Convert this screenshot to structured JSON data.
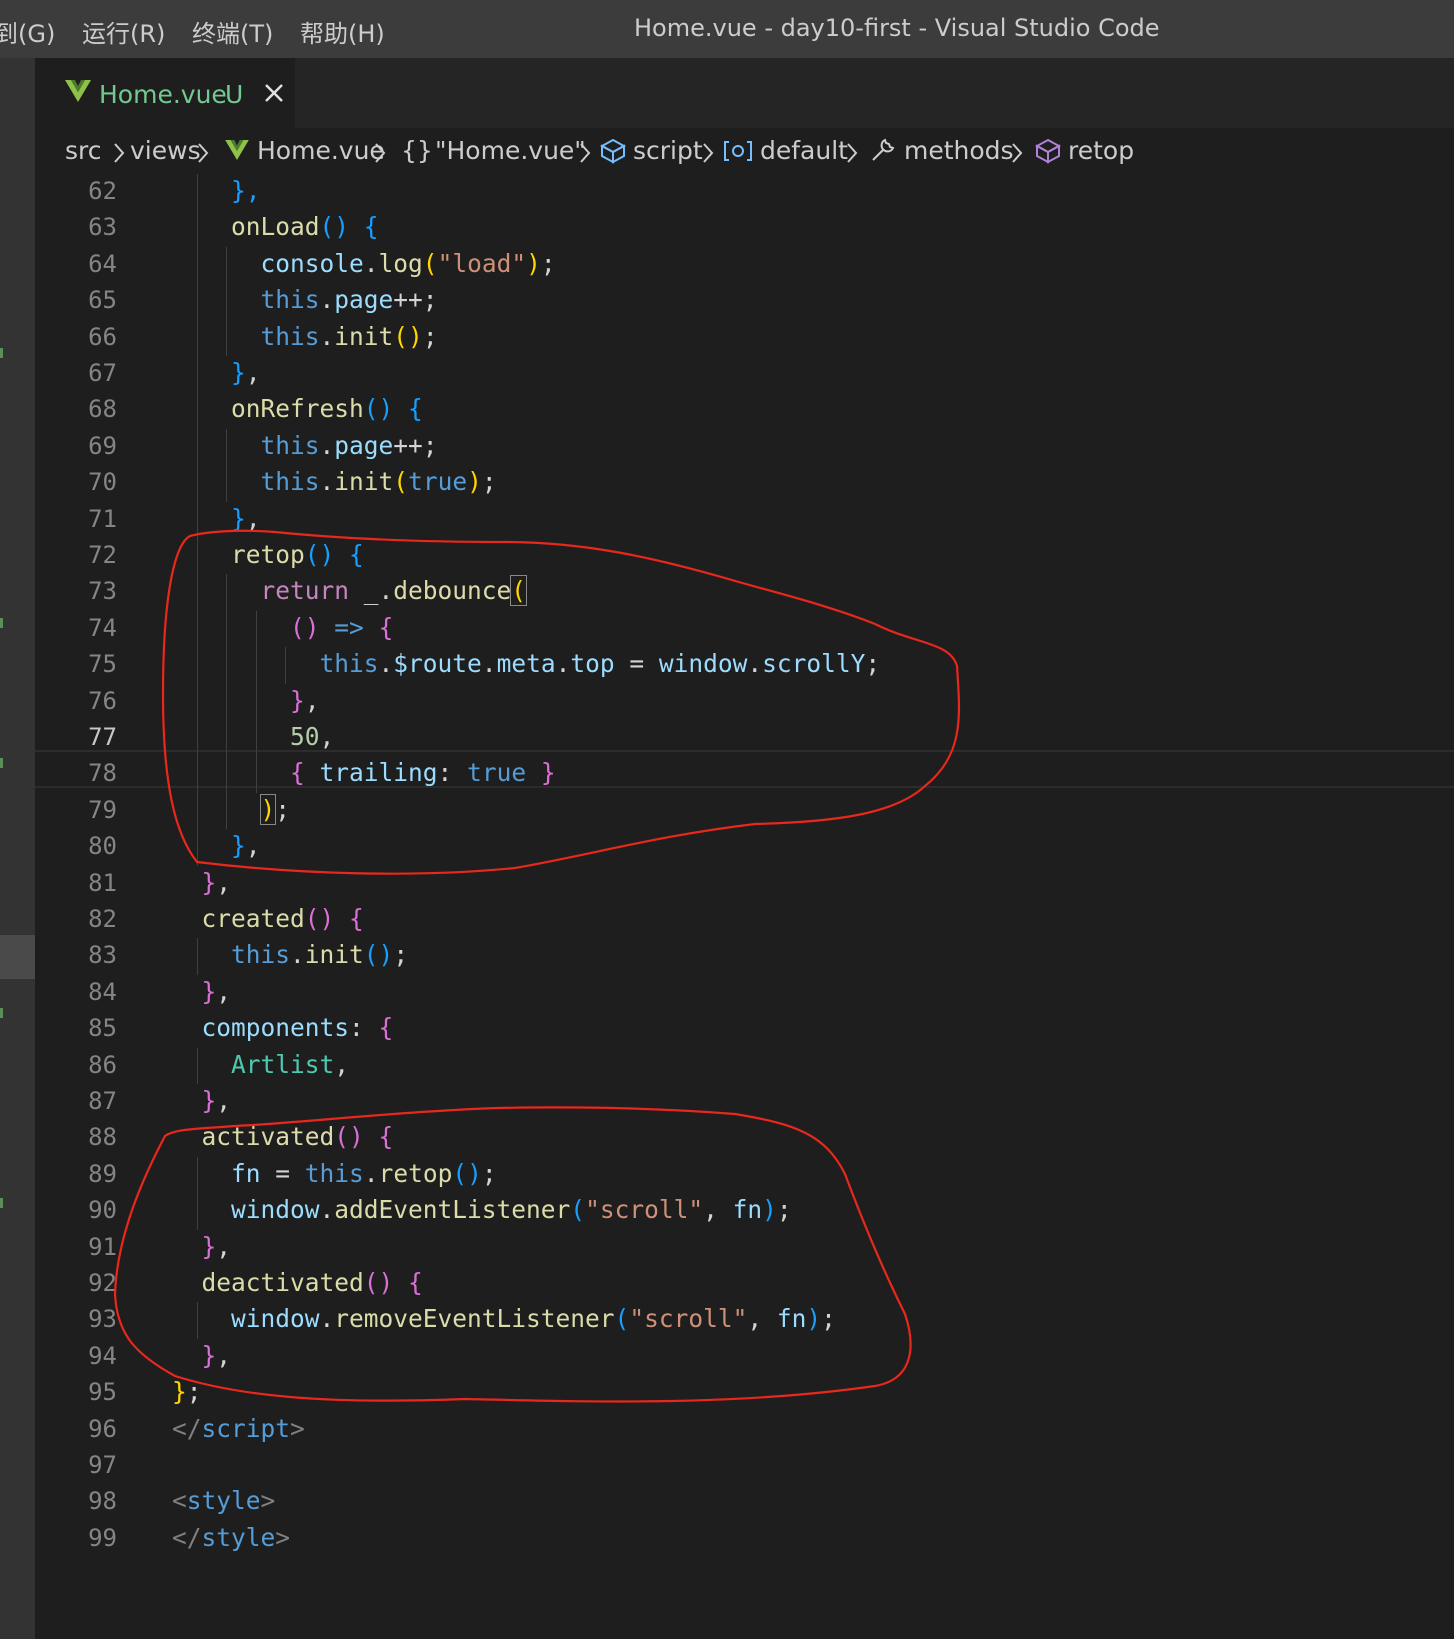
{
  "titlebar": {
    "menus": [
      "到(G)",
      "运行(R)",
      "终端(T)",
      "帮助(H)"
    ],
    "window_title": "Home.vue - day10-first - Visual Studio Code"
  },
  "tab": {
    "label": "Home.vue",
    "status": "U",
    "icon": "vue-icon",
    "close_icon": "close-icon"
  },
  "breadcrumb": {
    "items": [
      "src",
      "views",
      "Home.vue",
      "\"Home.vue\"",
      "script",
      "default",
      "methods",
      "retop"
    ],
    "icons": [
      "",
      "",
      "vue-icon",
      "braces-icon",
      "cube-icon",
      "variable-icon",
      "wrench-icon",
      "cube-icon"
    ]
  },
  "editor": {
    "active_line": 77,
    "lines": [
      {
        "n": 62,
        "indent": 2,
        "t": [
          [
            "},",
            "br3"
          ]
        ]
      },
      {
        "n": 63,
        "indent": 2,
        "t": [
          [
            "onLoad",
            "tk-fn"
          ],
          [
            "()",
            "br3"
          ],
          [
            " ",
            "tk-plain"
          ],
          [
            "{",
            "br3"
          ]
        ]
      },
      {
        "n": 64,
        "indent": 3,
        "t": [
          [
            "console",
            "tk-key"
          ],
          [
            ".",
            "tk-plain"
          ],
          [
            "log",
            "tk-fn"
          ],
          [
            "(",
            "br1"
          ],
          [
            "\"load\"",
            "tk-str"
          ],
          [
            ")",
            "br1"
          ],
          [
            ";",
            "tk-plain"
          ]
        ]
      },
      {
        "n": 65,
        "indent": 3,
        "t": [
          [
            "this",
            "tk-kw"
          ],
          [
            ".",
            "tk-plain"
          ],
          [
            "page",
            "tk-key"
          ],
          [
            "++;",
            "tk-plain"
          ]
        ]
      },
      {
        "n": 66,
        "indent": 3,
        "t": [
          [
            "this",
            "tk-kw"
          ],
          [
            ".",
            "tk-plain"
          ],
          [
            "init",
            "tk-fn"
          ],
          [
            "()",
            "br1"
          ],
          [
            ";",
            "tk-plain"
          ]
        ]
      },
      {
        "n": 67,
        "indent": 2,
        "t": [
          [
            "}",
            "br3"
          ],
          [
            ",",
            "tk-plain"
          ]
        ]
      },
      {
        "n": 68,
        "indent": 2,
        "t": [
          [
            "onRefresh",
            "tk-fn"
          ],
          [
            "()",
            "br3"
          ],
          [
            " ",
            "tk-plain"
          ],
          [
            "{",
            "br3"
          ]
        ]
      },
      {
        "n": 69,
        "indent": 3,
        "t": [
          [
            "this",
            "tk-kw"
          ],
          [
            ".",
            "tk-plain"
          ],
          [
            "page",
            "tk-key"
          ],
          [
            "++;",
            "tk-plain"
          ]
        ]
      },
      {
        "n": 70,
        "indent": 3,
        "t": [
          [
            "this",
            "tk-kw"
          ],
          [
            ".",
            "tk-plain"
          ],
          [
            "init",
            "tk-fn"
          ],
          [
            "(",
            "br1"
          ],
          [
            "true",
            "tk-kw"
          ],
          [
            ")",
            "br1"
          ],
          [
            ";",
            "tk-plain"
          ]
        ]
      },
      {
        "n": 71,
        "indent": 2,
        "t": [
          [
            "}",
            "br3"
          ],
          [
            ",",
            "tk-plain"
          ]
        ]
      },
      {
        "n": 72,
        "indent": 2,
        "t": [
          [
            "retop",
            "tk-fn"
          ],
          [
            "()",
            "br3"
          ],
          [
            " ",
            "tk-plain"
          ],
          [
            "{",
            "br3"
          ]
        ]
      },
      {
        "n": 73,
        "indent": 3,
        "t": [
          [
            "return",
            "tk-ctl"
          ],
          [
            " _.",
            "tk-plain"
          ],
          [
            "debounce",
            "tk-fn"
          ],
          [
            "(",
            "br1 match"
          ]
        ]
      },
      {
        "n": 74,
        "indent": 4,
        "t": [
          [
            "()",
            "br2"
          ],
          [
            " ",
            "tk-plain"
          ],
          [
            "=>",
            "tk-kw"
          ],
          [
            " ",
            "tk-plain"
          ],
          [
            "{",
            "br2"
          ]
        ]
      },
      {
        "n": 75,
        "indent": 5,
        "t": [
          [
            "this",
            "tk-kw"
          ],
          [
            ".",
            "tk-plain"
          ],
          [
            "$route",
            "tk-key"
          ],
          [
            ".",
            "tk-plain"
          ],
          [
            "meta",
            "tk-key"
          ],
          [
            ".",
            "tk-plain"
          ],
          [
            "top",
            "tk-key"
          ],
          [
            " = ",
            "tk-plain"
          ],
          [
            "window",
            "tk-key"
          ],
          [
            ".",
            "tk-plain"
          ],
          [
            "scrollY",
            "tk-key"
          ],
          [
            ";",
            "tk-plain"
          ]
        ]
      },
      {
        "n": 76,
        "indent": 4,
        "t": [
          [
            "}",
            "br2"
          ],
          [
            ",",
            "tk-plain"
          ]
        ]
      },
      {
        "n": 77,
        "indent": 4,
        "t": [
          [
            "50",
            "tk-num"
          ],
          [
            ",",
            "tk-plain"
          ]
        ]
      },
      {
        "n": 78,
        "indent": 4,
        "t": [
          [
            "{",
            "br2"
          ],
          [
            " ",
            "tk-plain"
          ],
          [
            "trailing",
            "tk-key"
          ],
          [
            ": ",
            "tk-plain"
          ],
          [
            "true",
            "tk-kw"
          ],
          [
            " ",
            "tk-plain"
          ],
          [
            "}",
            "br2"
          ]
        ]
      },
      {
        "n": 79,
        "indent": 3,
        "t": [
          [
            ")",
            "br1 match"
          ],
          [
            ";",
            "tk-plain"
          ]
        ]
      },
      {
        "n": 80,
        "indent": 2,
        "t": [
          [
            "}",
            "br3"
          ],
          [
            ",",
            "tk-plain"
          ]
        ]
      },
      {
        "n": 81,
        "indent": 1,
        "t": [
          [
            "}",
            "br2"
          ],
          [
            ",",
            "tk-plain"
          ]
        ]
      },
      {
        "n": 82,
        "indent": 1,
        "t": [
          [
            "created",
            "tk-fn"
          ],
          [
            "()",
            "br2"
          ],
          [
            " ",
            "tk-plain"
          ],
          [
            "{",
            "br2"
          ]
        ]
      },
      {
        "n": 83,
        "indent": 2,
        "t": [
          [
            "this",
            "tk-kw"
          ],
          [
            ".",
            "tk-plain"
          ],
          [
            "init",
            "tk-fn"
          ],
          [
            "()",
            "br3"
          ],
          [
            ";",
            "tk-plain"
          ]
        ]
      },
      {
        "n": 84,
        "indent": 1,
        "t": [
          [
            "}",
            "br2"
          ],
          [
            ",",
            "tk-plain"
          ]
        ]
      },
      {
        "n": 85,
        "indent": 1,
        "t": [
          [
            "components",
            "tk-key"
          ],
          [
            ": ",
            "tk-plain"
          ],
          [
            "{",
            "br2"
          ]
        ]
      },
      {
        "n": 86,
        "indent": 2,
        "t": [
          [
            "Artlist",
            "tk-type"
          ],
          [
            ",",
            "tk-plain"
          ]
        ]
      },
      {
        "n": 87,
        "indent": 1,
        "t": [
          [
            "}",
            "br2"
          ],
          [
            ",",
            "tk-plain"
          ]
        ]
      },
      {
        "n": 88,
        "indent": 1,
        "t": [
          [
            "activated",
            "tk-fn"
          ],
          [
            "()",
            "br2"
          ],
          [
            " ",
            "tk-plain"
          ],
          [
            "{",
            "br2"
          ]
        ]
      },
      {
        "n": 89,
        "indent": 2,
        "t": [
          [
            "fn",
            "tk-key"
          ],
          [
            " = ",
            "tk-plain"
          ],
          [
            "this",
            "tk-kw"
          ],
          [
            ".",
            "tk-plain"
          ],
          [
            "retop",
            "tk-fn"
          ],
          [
            "()",
            "br3"
          ],
          [
            ";",
            "tk-plain"
          ]
        ]
      },
      {
        "n": 90,
        "indent": 2,
        "t": [
          [
            "window",
            "tk-key"
          ],
          [
            ".",
            "tk-plain"
          ],
          [
            "addEventListener",
            "tk-fn"
          ],
          [
            "(",
            "br3"
          ],
          [
            "\"scroll\"",
            "tk-str"
          ],
          [
            ", ",
            "tk-plain"
          ],
          [
            "fn",
            "tk-key"
          ],
          [
            ")",
            "br3"
          ],
          [
            ";",
            "tk-plain"
          ]
        ]
      },
      {
        "n": 91,
        "indent": 1,
        "t": [
          [
            "}",
            "br2"
          ],
          [
            ",",
            "tk-plain"
          ]
        ]
      },
      {
        "n": 92,
        "indent": 1,
        "t": [
          [
            "deactivated",
            "tk-fn"
          ],
          [
            "()",
            "br2"
          ],
          [
            " ",
            "tk-plain"
          ],
          [
            "{",
            "br2"
          ]
        ]
      },
      {
        "n": 93,
        "indent": 2,
        "t": [
          [
            "window",
            "tk-key"
          ],
          [
            ".",
            "tk-plain"
          ],
          [
            "removeEventListener",
            "tk-fn"
          ],
          [
            "(",
            "br3"
          ],
          [
            "\"scroll\"",
            "tk-str"
          ],
          [
            ", ",
            "tk-plain"
          ],
          [
            "fn",
            "tk-key"
          ],
          [
            ")",
            "br3"
          ],
          [
            ";",
            "tk-plain"
          ]
        ]
      },
      {
        "n": 94,
        "indent": 1,
        "t": [
          [
            "}",
            "br2"
          ],
          [
            ",",
            "tk-plain"
          ]
        ]
      },
      {
        "n": 95,
        "indent": 0,
        "t": [
          [
            "}",
            "br1"
          ],
          [
            ";",
            "tk-plain"
          ]
        ]
      },
      {
        "n": 96,
        "indent": 0,
        "t": [
          [
            "</",
            "tk-punc"
          ],
          [
            "script",
            "tk-tag"
          ],
          [
            ">",
            "tk-punc"
          ]
        ]
      },
      {
        "n": 97,
        "indent": 0,
        "t": []
      },
      {
        "n": 98,
        "indent": 0,
        "t": [
          [
            "<",
            "tk-punc"
          ],
          [
            "style",
            "tk-tag"
          ],
          [
            ">",
            "tk-punc"
          ]
        ]
      },
      {
        "n": 99,
        "indent": 0,
        "t": [
          [
            "</",
            "tk-punc"
          ],
          [
            "style",
            "tk-tag"
          ],
          [
            ">",
            "tk-punc"
          ]
        ]
      }
    ]
  },
  "colors": {
    "editor_bg": "#1e1e1e",
    "titlebar_bg": "#3c3c3c",
    "tab_modified": "#73c991",
    "annotation": "#e8281d"
  }
}
